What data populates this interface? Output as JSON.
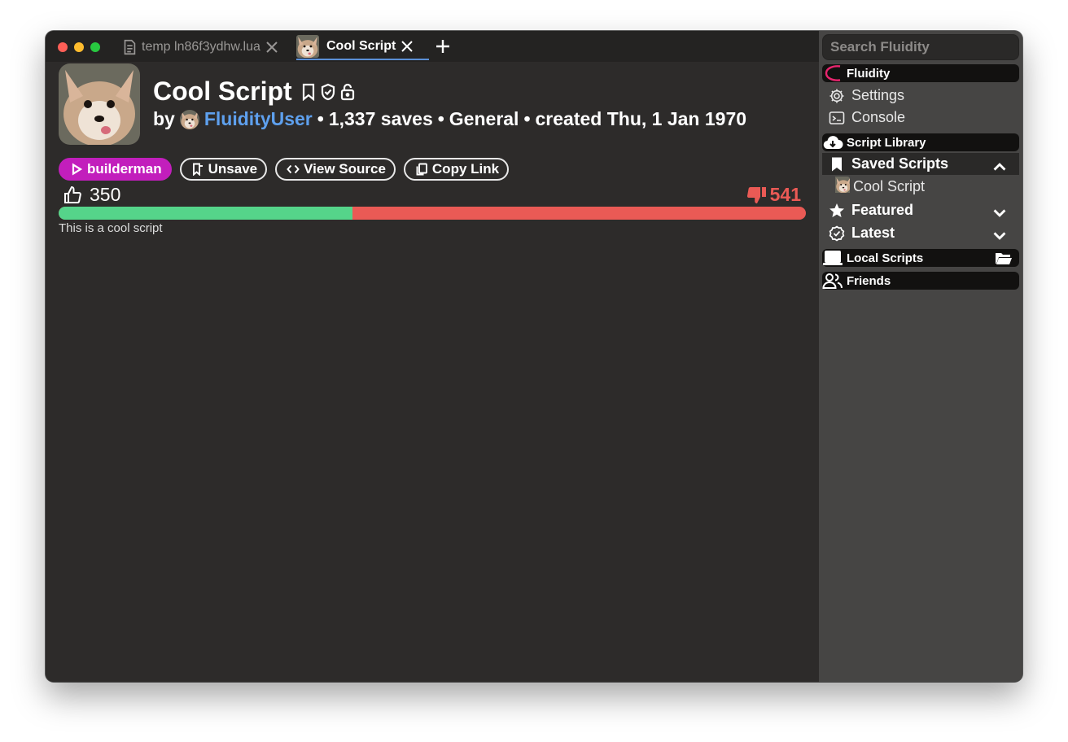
{
  "tabs": [
    {
      "label": "temp ln86f3ydhw.lua",
      "icon": "document-icon"
    },
    {
      "label": "Cool Script",
      "icon": "fox-thumbnail"
    }
  ],
  "script": {
    "title": "Cool Script",
    "by_label": "by",
    "author": "FluidityUser",
    "saves": "1,337 saves",
    "category": "General",
    "created": "created Thu, 1 Jan 1970",
    "separator": "•",
    "description": "This is a cool script"
  },
  "actions": {
    "execute_label": "builderman",
    "unsave_label": "Unsave",
    "view_source_label": "View Source",
    "copy_link_label": "Copy Link"
  },
  "rating": {
    "likes": "350",
    "dislikes": "541",
    "like_fraction": 0.3928
  },
  "sidebar": {
    "search_placeholder": "Search Fluidity",
    "fluidity_header": "Fluidity",
    "settings_label": "Settings",
    "console_label": "Console",
    "library_header": "Script Library",
    "saved_scripts_label": "Saved Scripts",
    "saved_items": [
      {
        "label": "Cool Script"
      }
    ],
    "featured_label": "Featured",
    "latest_label": "Latest",
    "local_scripts_header": "Local Scripts",
    "friends_header": "Friends"
  },
  "colors": {
    "window_bg": "#2d2b2a",
    "sidebar_bg": "#464544",
    "accent_blue": "#5ea0ee",
    "execute_purple": "#c21ebc",
    "like_green": "#55d48a",
    "dislike_red": "#ea5a55",
    "fluidity_pink": "#e8256e"
  }
}
